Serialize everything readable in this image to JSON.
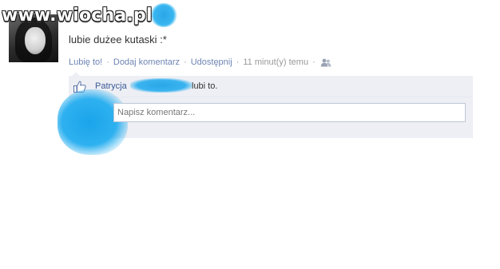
{
  "watermark": {
    "text": "www.wiocha.pl"
  },
  "post": {
    "text": "lubie dużee kutaski :*"
  },
  "actions": {
    "like_label": "Lubię to!",
    "comment_label": "Dodaj komentarz",
    "share_label": "Udostępnij",
    "separator": "·",
    "timestamp": "11 minut(y) temu",
    "audience_icon": "people-icon"
  },
  "likes": {
    "icon": "thumbs-up-icon",
    "name": "Patrycja",
    "suffix": "lubi to."
  },
  "comment": {
    "placeholder": "Napisz komentarz..."
  },
  "colors": {
    "link": "#3b5998",
    "action_link": "#6d84b4",
    "muted": "#999999",
    "comment_bg": "#edeff4",
    "input_border": "#bdc7d8",
    "redaction_blue": "#2aa6e8"
  }
}
